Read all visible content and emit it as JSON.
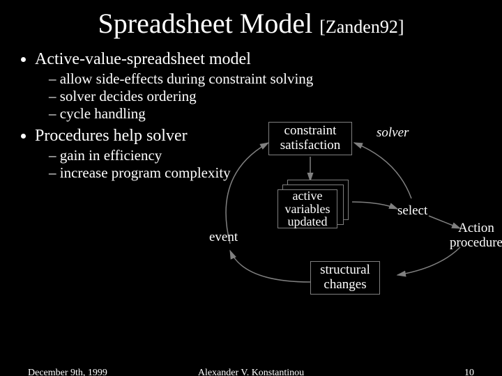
{
  "title": "Spreadsheet Model",
  "citation": "[Zanden92]",
  "bullets": {
    "b1": "Active-value-spreadsheet model",
    "b1_1": "allow side-effects during constraint solving",
    "b1_2": "solver decides ordering",
    "b1_3": "cycle handling",
    "b2": "Procedures help solver",
    "b2_1": "gain in efficiency",
    "b2_2": "increase program complexity"
  },
  "diagram": {
    "box1": "constraint satisfaction",
    "box2_l1": "active",
    "box2_l2": "variables",
    "box2_l3": "updated",
    "box3": "structural changes",
    "solver": "solver",
    "select": "select",
    "event": "event",
    "action_l1": "Action",
    "action_l2": "procedure"
  },
  "footer": {
    "date": "December 9th, 1999",
    "author": "Alexander V. Konstantinou",
    "page": "10"
  }
}
